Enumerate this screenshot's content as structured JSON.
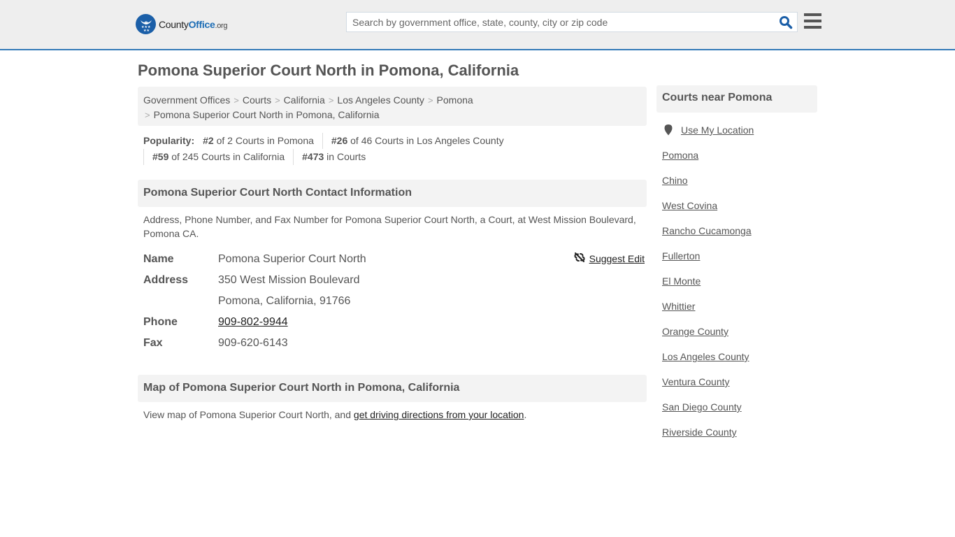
{
  "header": {
    "logo": {
      "county": "County",
      "office": "Office",
      "org": ".org"
    },
    "search": {
      "placeholder": "Search by government office, state, county, city or zip code",
      "value": ""
    },
    "colors": {
      "accent": "#337ab7",
      "brand_blue": "#1b5fa8",
      "search_icon": "#1b5fa8"
    }
  },
  "page_title": "Pomona Superior Court North in Pomona, California",
  "breadcrumb": [
    {
      "label": "Government Offices"
    },
    {
      "label": "Courts"
    },
    {
      "label": "California"
    },
    {
      "label": "Los Angeles County"
    },
    {
      "label": "Pomona"
    },
    {
      "label": "Pomona Superior Court North in Pomona, California"
    }
  ],
  "popularity": {
    "label": "Popularity:",
    "items": [
      {
        "rank": "#2",
        "text": " of 2 Courts in Pomona"
      },
      {
        "rank": "#26",
        "text": " of 46 Courts in Los Angeles County"
      },
      {
        "rank": "#59",
        "text": " of 245 Courts in California"
      },
      {
        "rank": "#473",
        "text": " in Courts"
      }
    ]
  },
  "contact": {
    "heading": "Pomona Superior Court North Contact Information",
    "description": "Address, Phone Number, and Fax Number for Pomona Superior Court North, a Court, at West Mission Boulevard, Pomona CA.",
    "suggest_edit": "Suggest Edit",
    "fields": {
      "name_label": "Name",
      "name_value": "Pomona Superior Court North",
      "address_label": "Address",
      "address_line1": "350 West Mission Boulevard",
      "address_line2": "Pomona, California, 91766",
      "phone_label": "Phone",
      "phone_value": "909-802-9944",
      "fax_label": "Fax",
      "fax_value": "909-620-6143"
    }
  },
  "map": {
    "heading": "Map of Pomona Superior Court North in Pomona, California",
    "text": "View map of Pomona Superior Court North, and ",
    "link": "get driving directions from your location",
    "suffix": "."
  },
  "sidebar": {
    "heading": "Courts near Pomona",
    "use_location": "Use My Location",
    "links": [
      "Pomona",
      "Chino",
      "West Covina",
      "Rancho Cucamonga",
      "Fullerton",
      "El Monte",
      "Whittier",
      "Orange County",
      "Los Angeles County",
      "Ventura County",
      "San Diego County",
      "Riverside County"
    ]
  }
}
